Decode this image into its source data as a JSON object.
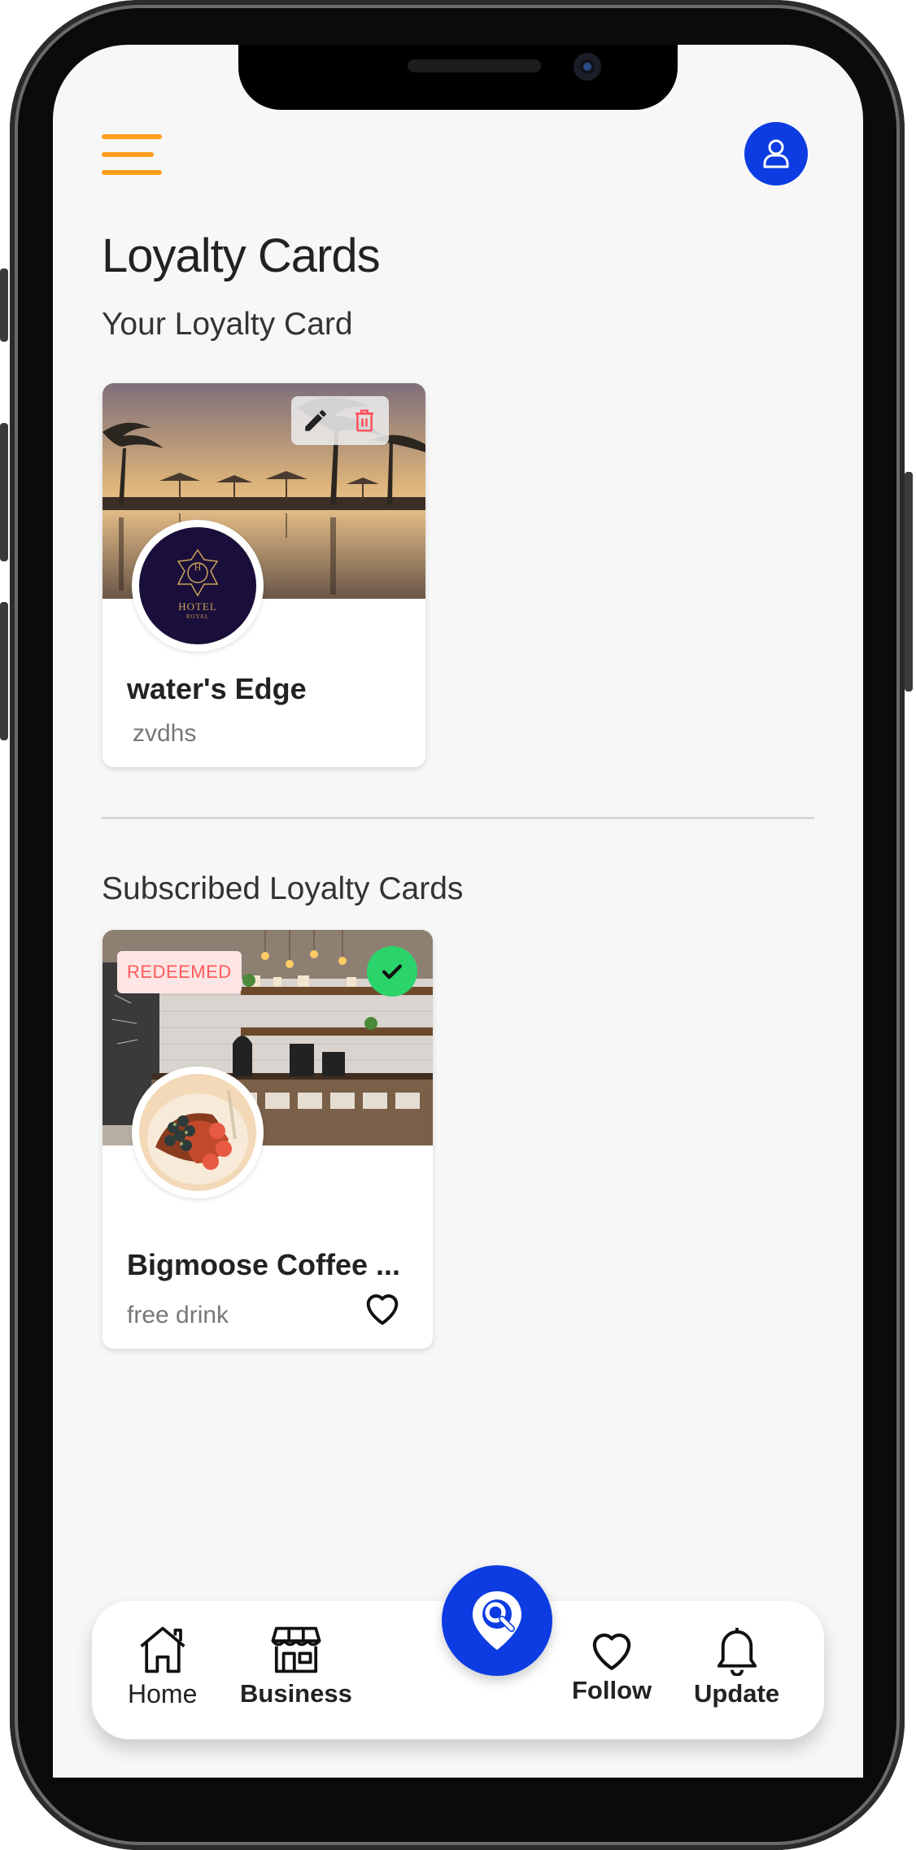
{
  "header": {
    "menu_icon": "hamburger-menu-icon",
    "profile_icon": "user-icon",
    "accent_color": "#ff9e1b",
    "brand_color": "#0d3de2"
  },
  "page": {
    "title": "Loyalty Cards",
    "your_section_label": "Your Loyalty Card",
    "subscribed_section_label": "Subscribed Loyalty Cards"
  },
  "your_card": {
    "title": "water's Edge",
    "subtitle": "zvdhs",
    "logo_text": "HOTEL",
    "logo_subtext": "ROYAL",
    "logo_monogram": "H",
    "edit_icon": "pencil-icon",
    "delete_icon": "trash-icon"
  },
  "subscribed_card": {
    "badge": "REDEEMED",
    "title": "Bigmoose Coffee ...",
    "subtitle": "free drink",
    "status_icon": "check-icon",
    "favorite_icon": "heart-outline-icon",
    "status_color": "#2bd46b",
    "badge_color": "#ff5a5a"
  },
  "bottom_nav": {
    "home": "Home",
    "business": "Business",
    "follow": "Follow",
    "update": "Update",
    "center_icon": "location-search-icon"
  }
}
